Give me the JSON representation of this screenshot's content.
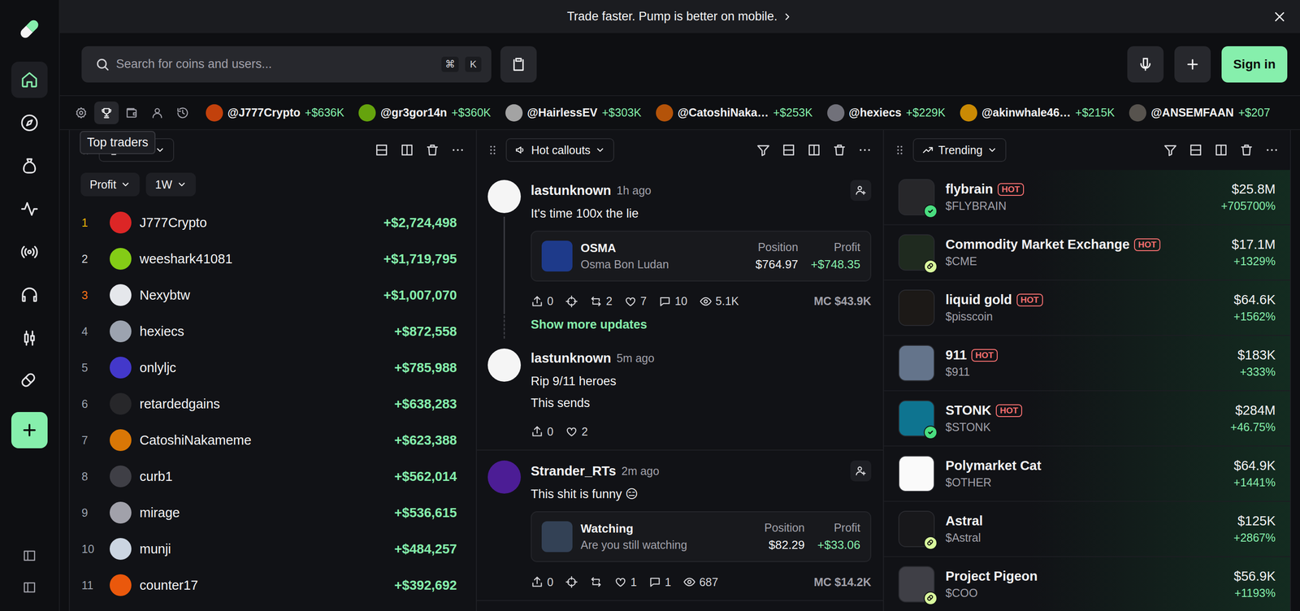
{
  "banner": {
    "text": "Trade faster. Pump is better on mobile."
  },
  "search": {
    "placeholder": "Search for coins and users...",
    "keys": [
      "⌘",
      "K"
    ]
  },
  "header": {
    "sign_in": "Sign in"
  },
  "sidebar": {
    "items": [
      {
        "kind": "home",
        "selected": true
      },
      {
        "kind": "compass",
        "selected": false
      },
      {
        "kind": "bag",
        "selected": false
      },
      {
        "kind": "activity",
        "selected": false
      },
      {
        "kind": "broadcast",
        "selected": false
      },
      {
        "kind": "headset",
        "selected": false
      },
      {
        "kind": "candles",
        "selected": false
      },
      {
        "kind": "pill",
        "selected": false
      }
    ]
  },
  "ticker": {
    "tabs": [
      {
        "kind": "settings",
        "selected": false
      },
      {
        "kind": "trophy",
        "selected": true
      },
      {
        "kind": "wallet",
        "selected": false
      },
      {
        "kind": "user",
        "selected": false
      },
      {
        "kind": "history",
        "selected": false
      }
    ],
    "traders": [
      {
        "handle": "@J777Crypto",
        "profit": "+$636K"
      },
      {
        "handle": "@gr3gor14n",
        "profit": "+$360K"
      },
      {
        "handle": "@HairlessEV",
        "profit": "+$303K"
      },
      {
        "handle": "@CatoshiNaka…",
        "profit": "+$253K"
      },
      {
        "handle": "@hexiecs",
        "profit": "+$229K"
      },
      {
        "handle": "@akinwhale46…",
        "profit": "+$215K"
      },
      {
        "handle": "@ANSEMFAAN",
        "profit": "+$207"
      }
    ]
  },
  "tooltip": "Top traders",
  "top_traders": {
    "title": "Profit",
    "filters": [
      "Profit",
      "1W"
    ],
    "rows": [
      {
        "rank": "1",
        "name": "J777Crypto",
        "profit": "+$2,724,498",
        "color": "#eab308"
      },
      {
        "rank": "2",
        "name": "weeshark41081",
        "profit": "+$1,719,795",
        "color": "#d4d4d8"
      },
      {
        "rank": "3",
        "name": "Nexybtw",
        "profit": "+$1,007,070",
        "color": "#f97316"
      },
      {
        "rank": "4",
        "name": "hexiecs",
        "profit": "+$872,558",
        "color": "#9ca3af"
      },
      {
        "rank": "5",
        "name": "onlyljc",
        "profit": "+$785,988",
        "color": "#9ca3af"
      },
      {
        "rank": "6",
        "name": "retardedgains",
        "profit": "+$638,283",
        "color": "#9ca3af"
      },
      {
        "rank": "7",
        "name": "CatoshiNakameme",
        "profit": "+$623,388",
        "color": "#9ca3af"
      },
      {
        "rank": "8",
        "name": "curb1",
        "profit": "+$562,014",
        "color": "#9ca3af"
      },
      {
        "rank": "9",
        "name": "mirage",
        "profit": "+$536,615",
        "color": "#9ca3af"
      },
      {
        "rank": "10",
        "name": "munji",
        "profit": "+$484,257",
        "color": "#9ca3af"
      },
      {
        "rank": "11",
        "name": "counter17",
        "profit": "+$392,692",
        "color": "#9ca3af"
      }
    ]
  },
  "callouts": {
    "title": "Hot callouts",
    "posts": [
      {
        "author": "lastunknown",
        "time": "1h ago",
        "follow": true,
        "thread": true,
        "lines": [
          "It's time 100x the lie"
        ],
        "card": {
          "title": "OSMA",
          "subtitle": "Osma Bon Ludan",
          "position_label": "Position",
          "position": "$764.97",
          "profit_label": "Profit",
          "profit": "+$748.35"
        },
        "actions": [
          {
            "kind": "share",
            "count": "0"
          },
          {
            "kind": "target"
          },
          {
            "kind": "repost",
            "count": "2"
          },
          {
            "kind": "like",
            "count": "7"
          },
          {
            "kind": "comment",
            "count": "10"
          },
          {
            "kind": "views",
            "count": "5.1K"
          }
        ],
        "mc": "MC $43.9K",
        "show_more": "Show more updates"
      },
      {
        "author": "lastunknown",
        "time": "5m ago",
        "follow": false,
        "thread": false,
        "lines": [
          "Rip 9/11 heroes",
          "This sends"
        ],
        "actions": [
          {
            "kind": "share",
            "count": "0"
          },
          {
            "kind": "like",
            "count": "2"
          }
        ]
      },
      {
        "author": "Strander_RTs",
        "time": "2m ago",
        "follow": true,
        "thread": false,
        "lines": [
          "This shit is funny 😑"
        ],
        "card": {
          "title": "Watching",
          "subtitle": "Are you still watching",
          "position_label": "Position",
          "position": "$82.29",
          "profit_label": "Profit",
          "profit": "+$33.06"
        },
        "actions": [
          {
            "kind": "share",
            "count": "0"
          },
          {
            "kind": "target"
          },
          {
            "kind": "repost"
          },
          {
            "kind": "like",
            "count": "1"
          },
          {
            "kind": "comment",
            "count": "1"
          },
          {
            "kind": "views",
            "count": "687"
          }
        ],
        "mc": "MC $14.2K"
      }
    ]
  },
  "trending": {
    "title": "Trending",
    "hot_label": "HOT",
    "coins": [
      {
        "name": "flybrain",
        "ticker": "$FLYBRAIN",
        "hot": true,
        "badge": "verified",
        "mc": "$25.8M",
        "change": "+705700%"
      },
      {
        "name": "Commodity Market Exchange",
        "ticker": "$CME",
        "hot": true,
        "badge": "pill",
        "mc": "$17.1M",
        "change": "+1329%"
      },
      {
        "name": "liquid gold",
        "ticker": "$pisscoin",
        "hot": true,
        "badge": "none",
        "mc": "$64.6K",
        "change": "+1562%"
      },
      {
        "name": "911",
        "ticker": "$911",
        "hot": true,
        "badge": "none",
        "mc": "$183K",
        "change": "+333%"
      },
      {
        "name": "STONK",
        "ticker": "$STONK",
        "hot": true,
        "badge": "verified",
        "mc": "$284M",
        "change": "+46.75%"
      },
      {
        "name": "Polymarket Cat",
        "ticker": "$OTHER",
        "hot": false,
        "badge": "none",
        "mc": "$64.9K",
        "change": "+1441%"
      },
      {
        "name": "Astral",
        "ticker": "$Astral",
        "hot": false,
        "badge": "pill",
        "mc": "$125K",
        "change": "+2867%"
      },
      {
        "name": "Project Pigeon",
        "ticker": "$COO",
        "hot": false,
        "badge": "pill",
        "mc": "$56.9K",
        "change": "+1193%"
      }
    ]
  }
}
